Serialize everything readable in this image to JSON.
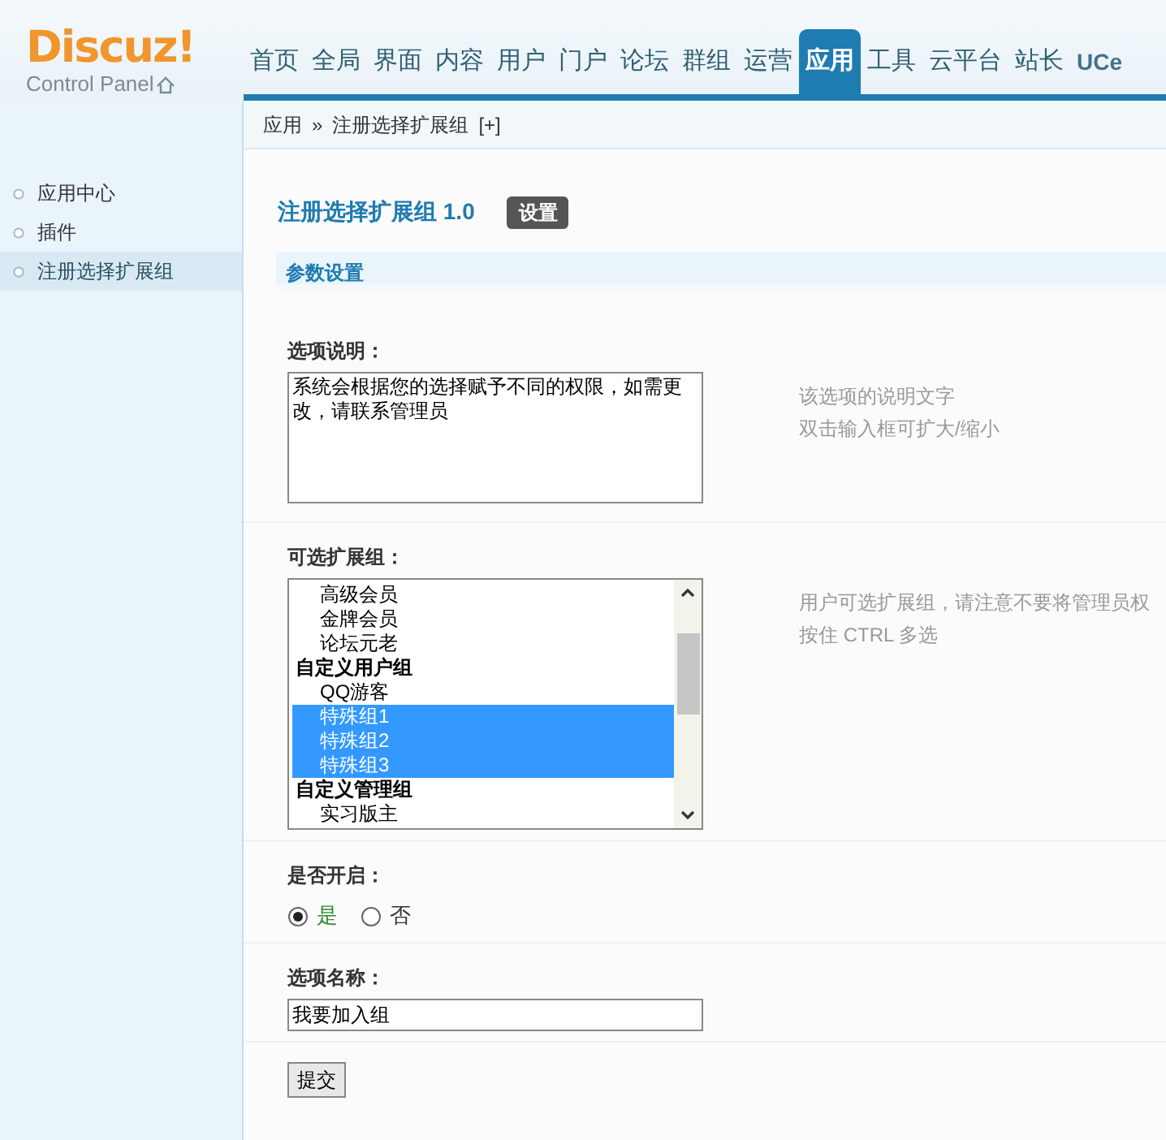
{
  "logo": {
    "name": "Discuz!",
    "subtitle": "Control Panel"
  },
  "nav": [
    {
      "label": "首页",
      "selected": false
    },
    {
      "label": "全局",
      "selected": false
    },
    {
      "label": "界面",
      "selected": false
    },
    {
      "label": "内容",
      "selected": false
    },
    {
      "label": "用户",
      "selected": false
    },
    {
      "label": "门户",
      "selected": false
    },
    {
      "label": "论坛",
      "selected": false
    },
    {
      "label": "群组",
      "selected": false
    },
    {
      "label": "运营",
      "selected": false
    },
    {
      "label": "应用",
      "selected": true
    },
    {
      "label": "工具",
      "selected": false
    },
    {
      "label": "云平台",
      "selected": false
    },
    {
      "label": "站长",
      "selected": false
    },
    {
      "label": "UCe",
      "selected": false
    }
  ],
  "breadcrumb": {
    "items": [
      "应用",
      "注册选择扩展组"
    ],
    "separator": "»",
    "add": "[+]"
  },
  "sidebar": [
    {
      "label": "应用中心",
      "selected": false
    },
    {
      "label": "插件",
      "selected": false
    },
    {
      "label": "注册选择扩展组",
      "selected": true
    }
  ],
  "page": {
    "title": "注册选择扩展组 1.0",
    "button": "设置"
  },
  "section": "参数设置",
  "fields": [
    {
      "kind": "textarea",
      "label": "选项说明：",
      "value": "系统会根据您的选择赋予不同的权限，如需更改，请联系管理员",
      "hints": [
        "该选项的说明文字",
        "双击输入框可扩大/缩小"
      ]
    },
    {
      "kind": "listbox",
      "label": "可选扩展组：",
      "hints": [
        "用户可选扩展组，请注意不要将管理员权",
        "按住 CTRL 多选"
      ],
      "options": [
        {
          "kind": "option",
          "label": "高级会员",
          "selected": false
        },
        {
          "kind": "option",
          "label": "金牌会员",
          "selected": false
        },
        {
          "kind": "option",
          "label": "论坛元老",
          "selected": false
        },
        {
          "kind": "group",
          "label": "自定义用户组"
        },
        {
          "kind": "option",
          "label": "QQ游客",
          "selected": false
        },
        {
          "kind": "option",
          "label": "特殊组1",
          "selected": true
        },
        {
          "kind": "option",
          "label": "特殊组2",
          "selected": true
        },
        {
          "kind": "option",
          "label": "特殊组3",
          "selected": true
        },
        {
          "kind": "group",
          "label": "自定义管理组"
        },
        {
          "kind": "option",
          "label": "实习版主",
          "selected": false
        }
      ]
    },
    {
      "kind": "radio",
      "label": "是否开启：",
      "options": [
        {
          "label": "是",
          "selected": true
        },
        {
          "label": "否",
          "selected": false
        }
      ]
    },
    {
      "kind": "text",
      "label": "选项名称：",
      "value": "我要加入组"
    }
  ],
  "submit": "提交"
}
